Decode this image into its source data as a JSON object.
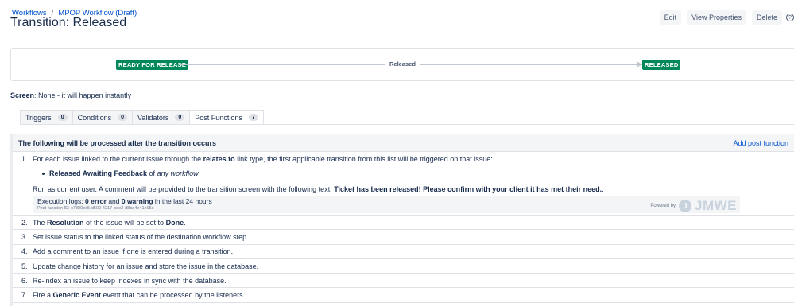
{
  "breadcrumb": {
    "items": [
      "Workflows",
      "MPOP Workflow (Draft)"
    ],
    "separator": "/"
  },
  "title": "Transition: Released",
  "actions": {
    "edit": "Edit",
    "view_properties": "View Properties",
    "delete": "Delete",
    "help_glyph": "?"
  },
  "diagram": {
    "from_status": "READY FOR RELEASE",
    "transition": "Released",
    "to_status": "RELEASED"
  },
  "screen": {
    "label": "Screen",
    "value": ": None - it will happen instantly"
  },
  "tabs": [
    {
      "label": "Triggers",
      "count": "0"
    },
    {
      "label": "Conditions",
      "count": "0"
    },
    {
      "label": "Validators",
      "count": "0"
    },
    {
      "label": "Post Functions",
      "count": "7"
    }
  ],
  "panel": {
    "heading": "The following will be processed after the transition occurs",
    "add_link": "Add post function"
  },
  "post_function_1": {
    "num": "1.",
    "text_a": "For each issue linked to the current issue through the ",
    "text_b": "relates to",
    "text_c": " link type, the first applicable transition from this list will be triggered on that issue:",
    "bullet_bold": "Released Awaiting Feedback",
    "bullet_of": " of ",
    "bullet_italic": "any workflow",
    "runas_a": "Run as current user. A comment will be provided to the transition screen with the following text: ",
    "runas_b": "Ticket has been released! Please confirm with your client it has met their need.",
    "runas_c": ".",
    "logs_a": "Execution logs: ",
    "logs_b": "0 error",
    "logs_c": " and ",
    "logs_d": "0 warning",
    "logs_e": " in the last 24 hours",
    "post_function_id": "Post-function ID: c7380bc5-d500-4217-bee3-d8ba4e41e05c",
    "powered_by": "Powered by",
    "logo_text": "JMWE",
    "logo_glyph": "J"
  },
  "post_function_2": {
    "num": "2.",
    "a": "The ",
    "b": "Resolution",
    "c": " of the issue will be set to ",
    "d": "Done",
    "e": "."
  },
  "post_function_3": {
    "num": "3.",
    "text": "Set issue status to the linked status of the destination workflow step."
  },
  "post_function_4": {
    "num": "4.",
    "text": "Add a comment to an issue if one is entered during a transition."
  },
  "post_function_5": {
    "num": "5.",
    "text": "Update change history for an issue and store the issue in the database."
  },
  "post_function_6": {
    "num": "6.",
    "text": "Re-index an issue to keep indexes in sync with the database."
  },
  "post_function_7": {
    "num": "7.",
    "a": "Fire a ",
    "b": "Generic Event",
    "c": " event that can be processed by the listeners."
  },
  "colors": {
    "status_green": "#00875a",
    "link_blue": "#0052cc",
    "panel_bg": "#f4f5f7"
  }
}
